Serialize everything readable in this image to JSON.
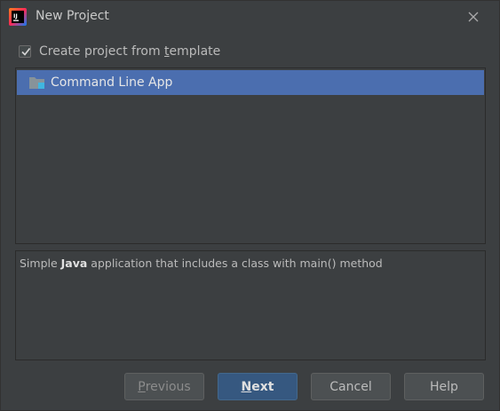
{
  "window": {
    "title": "New Project",
    "app_icon": "intellij-idea-icon",
    "close_icon": "close-icon"
  },
  "template_toggle": {
    "label_before": "Create project from ",
    "label_mnemonic": "t",
    "label_after": "emplate",
    "checked": true
  },
  "templates": {
    "items": [
      {
        "label": "Command Line App",
        "icon": "folder-module-icon",
        "selected": true
      }
    ]
  },
  "description": {
    "prefix": "Simple ",
    "emphasis": "Java",
    "suffix": " application that includes a class with main() method"
  },
  "buttons": {
    "previous_mnemonic": "P",
    "previous_rest": "revious",
    "next_mnemonic": "N",
    "next_rest": "ext",
    "cancel": "Cancel",
    "help": "Help"
  },
  "colors": {
    "background": "#3c3f41",
    "selection": "#4b6eaf",
    "default_button": "#365880"
  }
}
